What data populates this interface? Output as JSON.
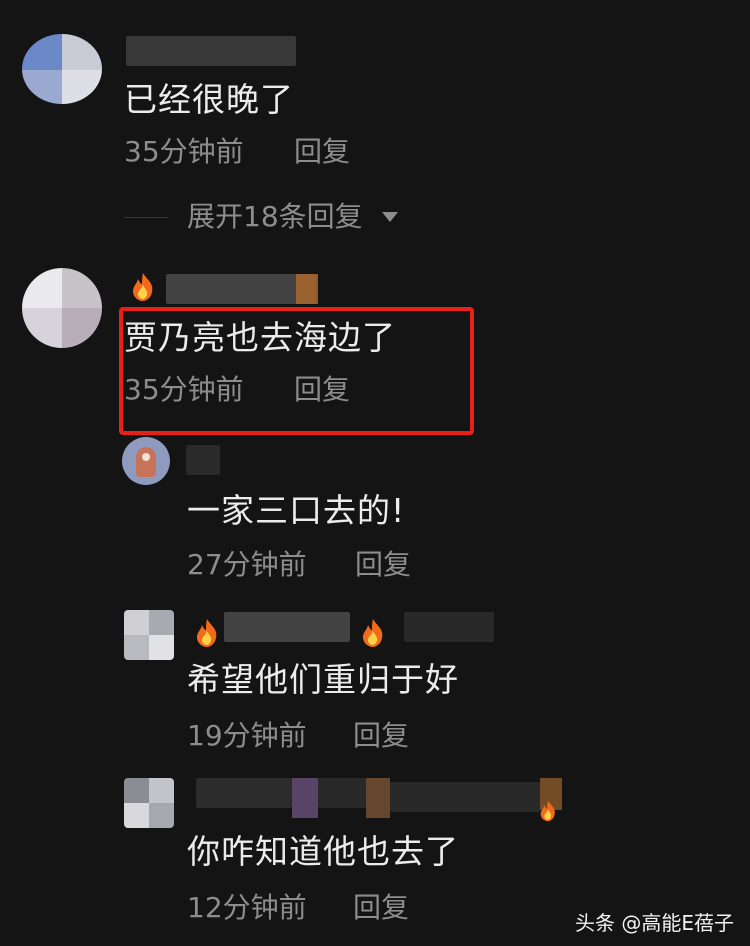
{
  "comments": [
    {
      "text": "已经很晚了",
      "time": "35分钟前",
      "reply_label": "回复",
      "expand_label": "展开18条回复"
    },
    {
      "text": "贾乃亮也去海边了",
      "time": "35分钟前",
      "reply_label": "回复",
      "highlight_color": "#e8201a"
    },
    {
      "text": "一家三口去的!",
      "time": "27分钟前",
      "reply_label": "回复"
    },
    {
      "text": "希望他们重归于好",
      "time": "19分钟前",
      "reply_label": "回复"
    },
    {
      "text": "你咋知道他也去了",
      "time": "12分钟前",
      "reply_label": "回复"
    }
  ],
  "icons": {
    "fire": "fire-icon",
    "expand": "caret-down-icon"
  },
  "watermark": "头条 @高能E蓓子",
  "colors": {
    "background": "#141414",
    "text": "#ececec",
    "meta": "#8d8d8d",
    "highlight": "#e8201a"
  }
}
